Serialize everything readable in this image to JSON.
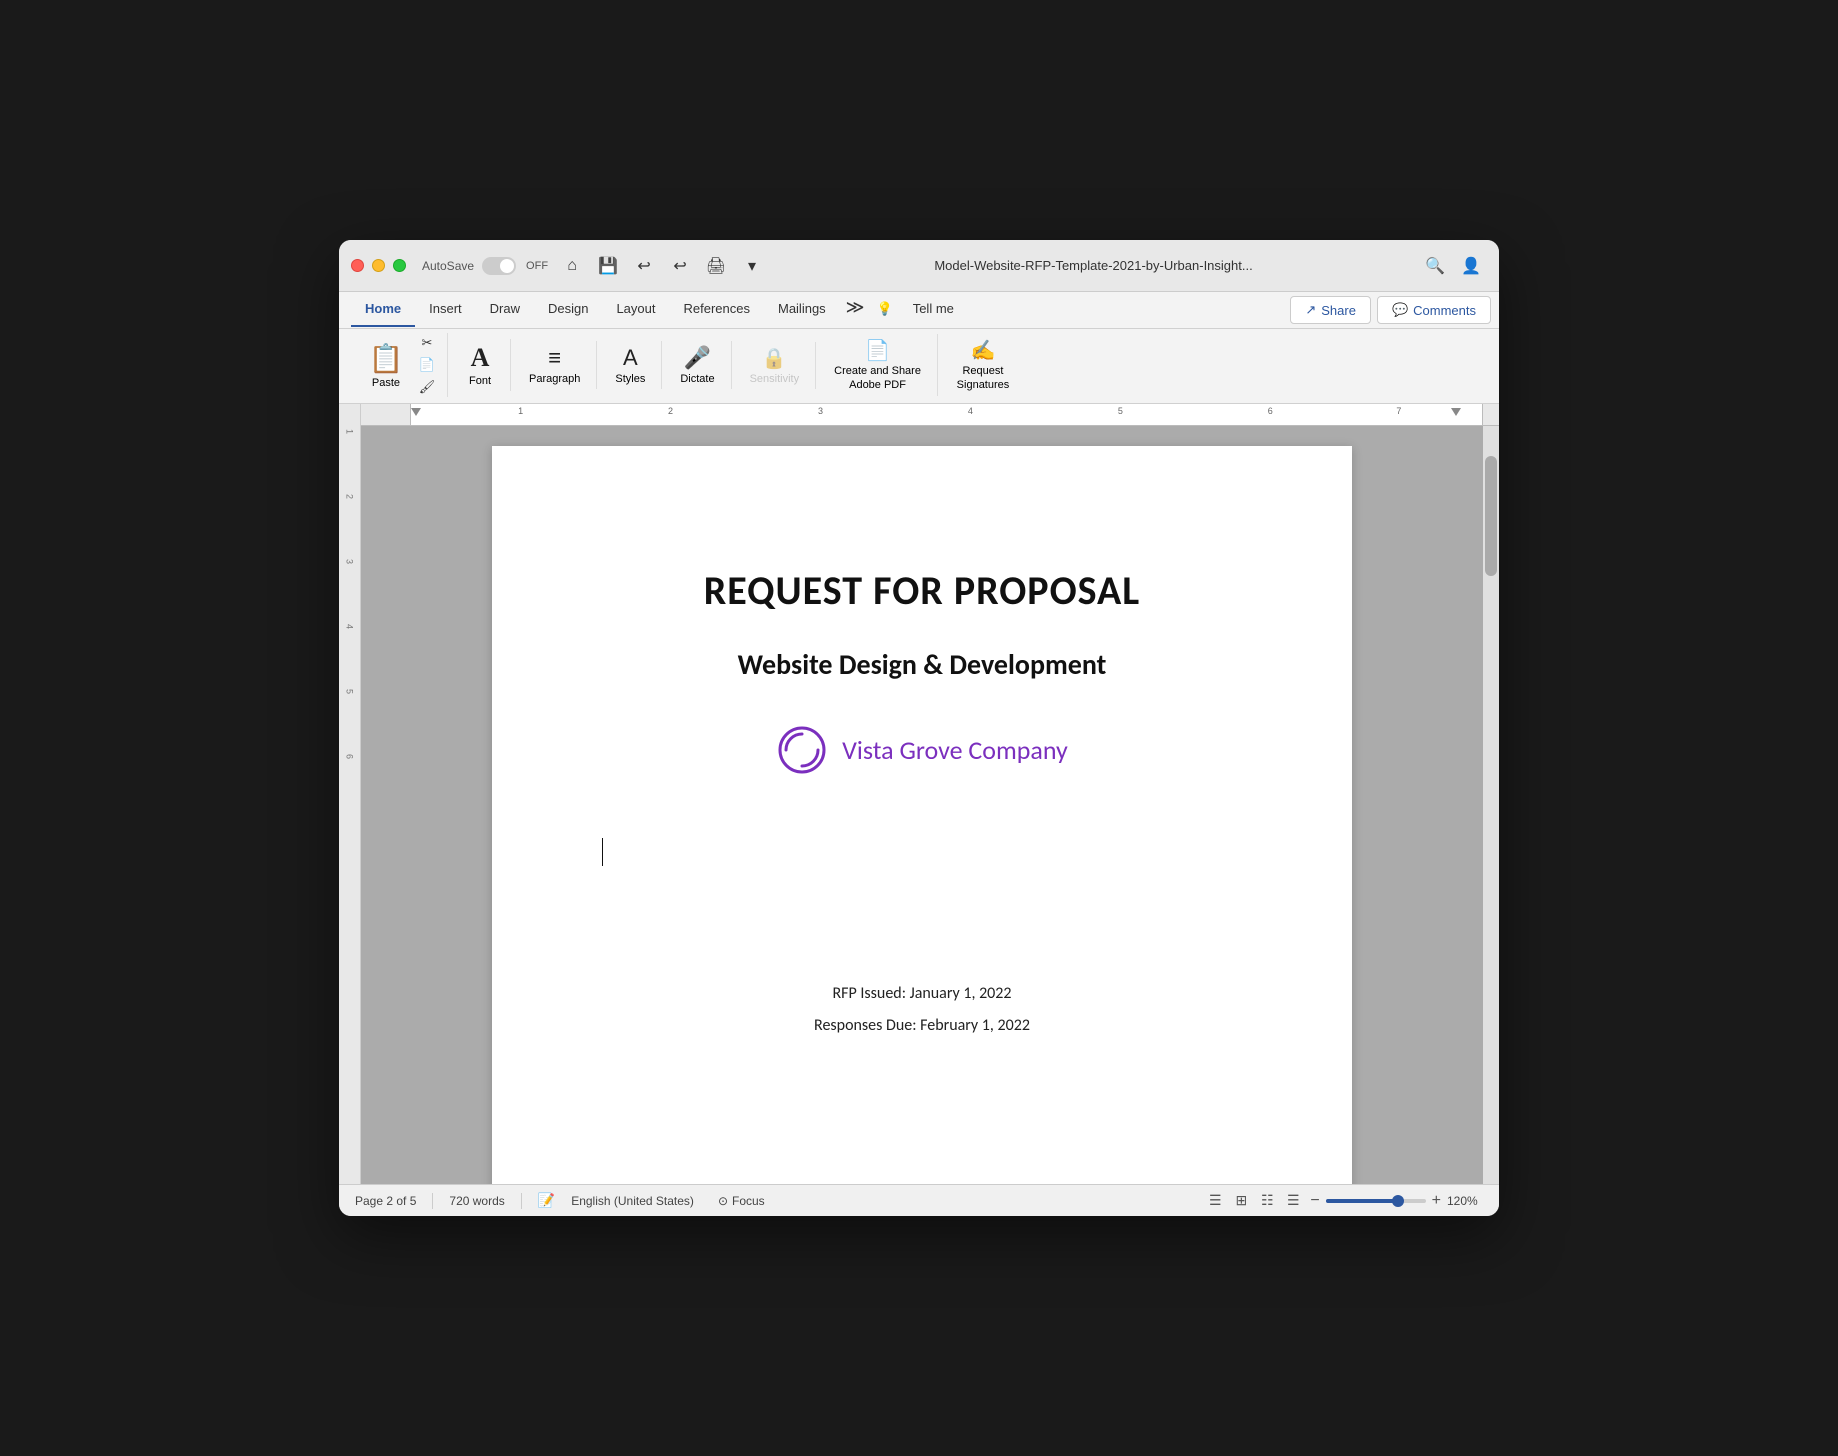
{
  "window": {
    "title": "Model-Website-RFP-Template-2021-by-Urban-Insight...",
    "autosave_label": "AutoSave",
    "toggle_state": "OFF"
  },
  "ribbon": {
    "tabs": [
      {
        "label": "Home",
        "active": true
      },
      {
        "label": "Insert",
        "active": false
      },
      {
        "label": "Draw",
        "active": false
      },
      {
        "label": "Design",
        "active": false
      },
      {
        "label": "Layout",
        "active": false
      },
      {
        "label": "References",
        "active": false
      },
      {
        "label": "Mailings",
        "active": false
      },
      {
        "label": "Tell me",
        "active": false
      }
    ],
    "share_label": "Share",
    "comments_label": "Comments"
  },
  "toolbar": {
    "paste_label": "Paste",
    "font_label": "Font",
    "paragraph_label": "Paragraph",
    "styles_label": "Styles",
    "dictate_label": "Dictate",
    "sensitivity_label": "Sensitivity",
    "create_share_pdf_label": "Create and Share\nAdobe PDF",
    "request_signatures_label": "Request\nSignatures"
  },
  "document": {
    "title": "REQUEST FOR PROPOSAL",
    "subtitle": "Website Design & Development",
    "company_name": "Vista Grove Company",
    "rfp_issued": "RFP Issued: January 1, 2022",
    "responses_due": "Responses Due: February 1, 2022"
  },
  "status_bar": {
    "page_info": "Page 2 of 5",
    "word_count": "720 words",
    "language": "English (United States)",
    "focus_label": "Focus",
    "zoom_level": "120%"
  },
  "colors": {
    "accent_blue": "#2c57a0",
    "purple": "#7b2fbe",
    "active_tab": "#2c57a0"
  }
}
